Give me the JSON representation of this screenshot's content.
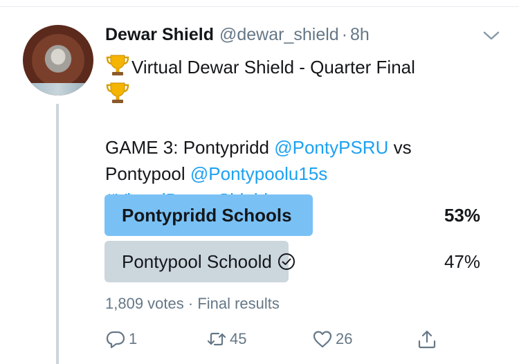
{
  "tweet": {
    "display_name": "Dewar Shield",
    "handle": "@dewar_shield",
    "separator": "·",
    "time": "8h",
    "title_text": "Virtual Dewar Shield - Quarter Final",
    "game_prefix": "GAME 3: Pontypridd ",
    "mention_1": "@PontyPSRU",
    "vs_text": " vs",
    "team_2": "Pontypool ",
    "mention_2": "@Pontypoolu15s",
    "hashtag": "#VirtualDewarShield"
  },
  "poll": {
    "options": [
      {
        "label": "Pontypridd Schools",
        "percent_text": "53%",
        "percent": 53,
        "winner": true,
        "color": "#79c1f5"
      },
      {
        "label": "Pontypool Schoold",
        "percent_text": "47%",
        "percent": 47,
        "winner": false,
        "voted": true,
        "color": "#ccd6dd"
      }
    ],
    "votes": "1,809 votes",
    "meta_separator": " · ",
    "status": "Final results"
  },
  "actions": {
    "reply_count": "1",
    "retweet_count": "45",
    "like_count": "26",
    "icons": [
      "reply-icon",
      "retweet-icon",
      "like-icon",
      "share-icon"
    ]
  },
  "colors": {
    "link": "#1da1f2",
    "secondary_text": "#657786",
    "winner_bar": "#79c1f5",
    "loser_bar": "#ccd6dd"
  }
}
